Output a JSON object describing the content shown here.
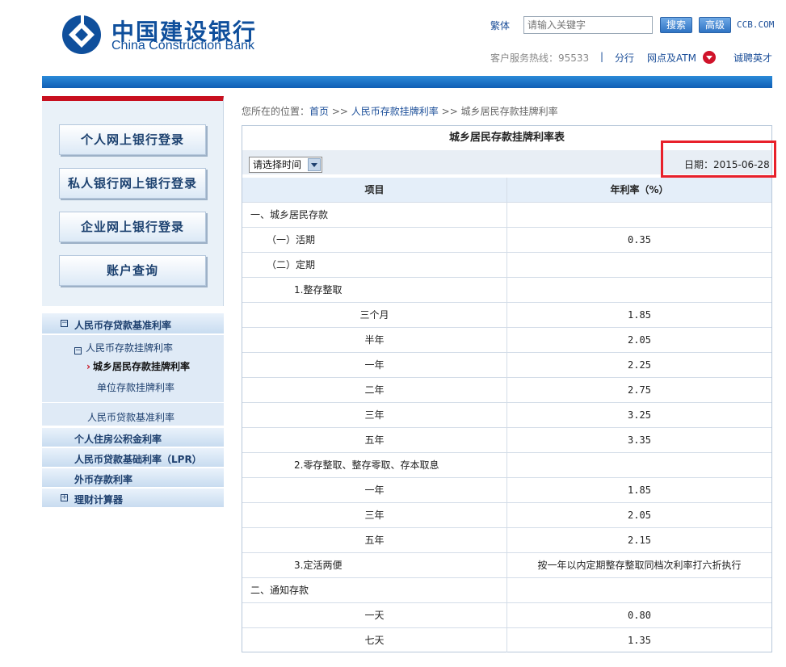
{
  "header": {
    "logo_cn": "中国建设银行",
    "logo_en": "China Construction Bank",
    "traditional": "繁体",
    "search_placeholder": "请输入关键字",
    "search_button": "搜索",
    "advanced_button": "高级",
    "site": "CCB.COM",
    "hotline": "客户服务热线：95533",
    "sep": "|",
    "branches": "分行",
    "atm": "网点及ATM",
    "careers": "诚聘英才"
  },
  "sidebar": {
    "login_buttons": [
      "个人网上银行登录",
      "私人银行网上银行登录",
      "企业网上银行登录",
      "账户查询"
    ],
    "menu": {
      "rmb_base_rate": "人民币存贷款基准利率",
      "rmb_deposit_listed": "人民币存款挂牌利率",
      "urban_rural": "城乡居民存款挂牌利率",
      "unit_deposit": "单位存款挂牌利率",
      "rmb_loan_base": "人民币贷款基准利率",
      "housing_fund": "个人住房公积金利率",
      "lpr": "人民币贷款基础利率（LPR）",
      "forex": "外币存款利率",
      "calculator": "理财计算器"
    }
  },
  "breadcrumb": {
    "prefix": "您所在的位置：",
    "home": "首页",
    "sep": ">>",
    "level1": "人民币存款挂牌利率",
    "level2": "城乡居民存款挂牌利率"
  },
  "table": {
    "title": "城乡居民存款挂牌利率表",
    "select_label": "请选择时间",
    "date": "日期：2015-06-28",
    "col_item": "项目",
    "col_rate": "年利率（%）",
    "rows": [
      {
        "item": "一、城乡居民存款",
        "rate": ""
      },
      {
        "item": "（一）活期",
        "rate": "0.35"
      },
      {
        "item": "（二）定期",
        "rate": ""
      },
      {
        "item": "1.整存整取",
        "rate": ""
      },
      {
        "item": "三个月",
        "rate": "1.85"
      },
      {
        "item": "半年",
        "rate": "2.05"
      },
      {
        "item": "一年",
        "rate": "2.25"
      },
      {
        "item": "二年",
        "rate": "2.75"
      },
      {
        "item": "三年",
        "rate": "3.25"
      },
      {
        "item": "五年",
        "rate": "3.35"
      },
      {
        "item": "2.零存整取、整存零取、存本取息",
        "rate": ""
      },
      {
        "item": "一年",
        "rate": "1.85"
      },
      {
        "item": "三年",
        "rate": "2.05"
      },
      {
        "item": "五年",
        "rate": "2.15"
      },
      {
        "item": "3.定活两便",
        "rate": "按一年以内定期整存整取同档次利率打六折执行"
      },
      {
        "item": "二、通知存款",
        "rate": ""
      },
      {
        "item": "一天",
        "rate": "0.80"
      },
      {
        "item": "七天",
        "rate": "1.35"
      }
    ]
  },
  "colors": {
    "brand_blue": "#0f4f9c",
    "accent_red": "#e8202a"
  }
}
